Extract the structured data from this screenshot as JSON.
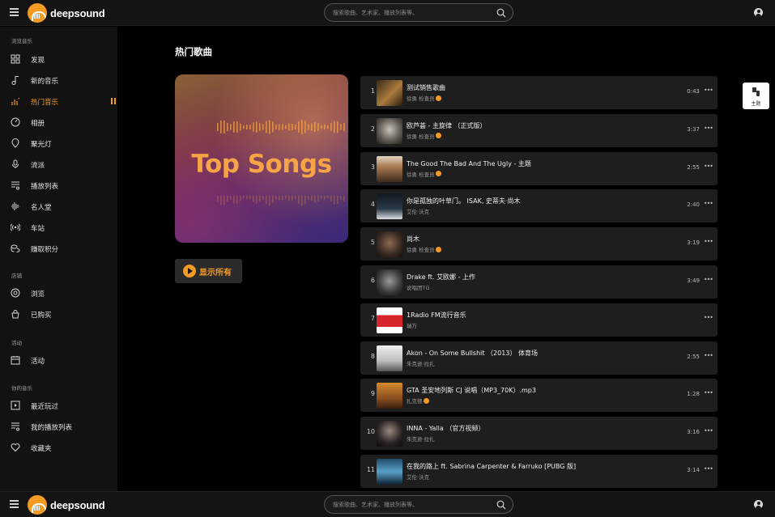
{
  "header": {
    "brand": "deepsound",
    "search_placeholder": "搜索歌曲、艺术家、播放列表等。"
  },
  "footer": {
    "brand": "deepsound",
    "search_placeholder": "搜索歌曲、艺术家、播放列表等。"
  },
  "sidebar": {
    "browse_title": "浏览音乐",
    "browse": [
      {
        "label": "发现",
        "icon": "grid-icon"
      },
      {
        "label": "新的音乐",
        "icon": "music-note-icon"
      },
      {
        "label": "热门音乐",
        "icon": "fire-icon",
        "active": true
      },
      {
        "label": "相册",
        "icon": "disc-icon"
      },
      {
        "label": "聚光灯",
        "icon": "spotlight-icon"
      },
      {
        "label": "流派",
        "icon": "microphone-icon"
      },
      {
        "label": "播放列表",
        "icon": "playlist-icon"
      },
      {
        "label": "名人堂",
        "icon": "waveform-icon"
      },
      {
        "label": "车站",
        "icon": "radio-icon"
      },
      {
        "label": "赚取积分",
        "icon": "coins-icon"
      }
    ],
    "store_title": "店铺",
    "store": [
      {
        "label": "浏览",
        "icon": "browse-icon"
      },
      {
        "label": "已购买",
        "icon": "purchased-icon"
      }
    ],
    "events_title": "活动",
    "events": [
      {
        "label": "活动",
        "icon": "calendar-icon"
      }
    ],
    "my_music_title": "你的音乐",
    "my_music": [
      {
        "label": "最近玩过",
        "icon": "recent-play-icon"
      },
      {
        "label": "我的播放列表",
        "icon": "my-playlist-icon"
      },
      {
        "label": "收藏夹",
        "icon": "heart-icon"
      }
    ]
  },
  "main": {
    "title": "热门歌曲",
    "cover_title": "Top Songs",
    "play_all_label": "显示所有",
    "accent_color": "#f59a23"
  },
  "tracks": [
    {
      "num": "1",
      "title": "测试销售歌曲",
      "artist": "徐勇 检查员",
      "verified": true,
      "duration": "0:43"
    },
    {
      "num": "2",
      "title": "欧芦荟 - 主旋律 （正式版）",
      "artist": "徐勇 检查员",
      "verified": true,
      "duration": "3:37"
    },
    {
      "num": "3",
      "title": "The Good The Bad And The Ugly - 主题",
      "artist": "徐勇 检查员",
      "verified": true,
      "duration": "2:55"
    },
    {
      "num": "4",
      "title": "你是孤独的叶草门。 ISAK, 史蒂夫·尚木",
      "artist": "艾伦·沃克",
      "verified": false,
      "duration": "2:40"
    },
    {
      "num": "5",
      "title": "尚木",
      "artist": "徐勇 检查员",
      "verified": true,
      "duration": "3:19"
    },
    {
      "num": "6",
      "title": "Drake ft. 艾欧娜 - 上作",
      "artist": "说唱团TG",
      "verified": false,
      "duration": "3:49"
    },
    {
      "num": "7",
      "title": "1Radio FM流行音乐",
      "artist": "瑞万",
      "verified": false,
      "duration": ""
    },
    {
      "num": "8",
      "title": "Akon - On Some Bullshit （2013） 体育场",
      "artist": "朱克逊·拉扎",
      "verified": false,
      "duration": "2:55"
    },
    {
      "num": "9",
      "title": "GTA 圣安地列斯 CJ 说唱（MP3_70K）.mp3",
      "artist": "扎克德",
      "verified": true,
      "duration": "1:28"
    },
    {
      "num": "10",
      "title": "INNA - Yalla （官方视频）",
      "artist": "朱克逊·拉扎",
      "verified": false,
      "duration": "3:16"
    },
    {
      "num": "11",
      "title": "在我的路上 ft. Sabrina Carpenter & Farruko [PUBG 版]",
      "artist": "艾伦·沃克",
      "verified": false,
      "duration": "3:14"
    }
  ],
  "theme_button": {
    "label": "主题"
  }
}
